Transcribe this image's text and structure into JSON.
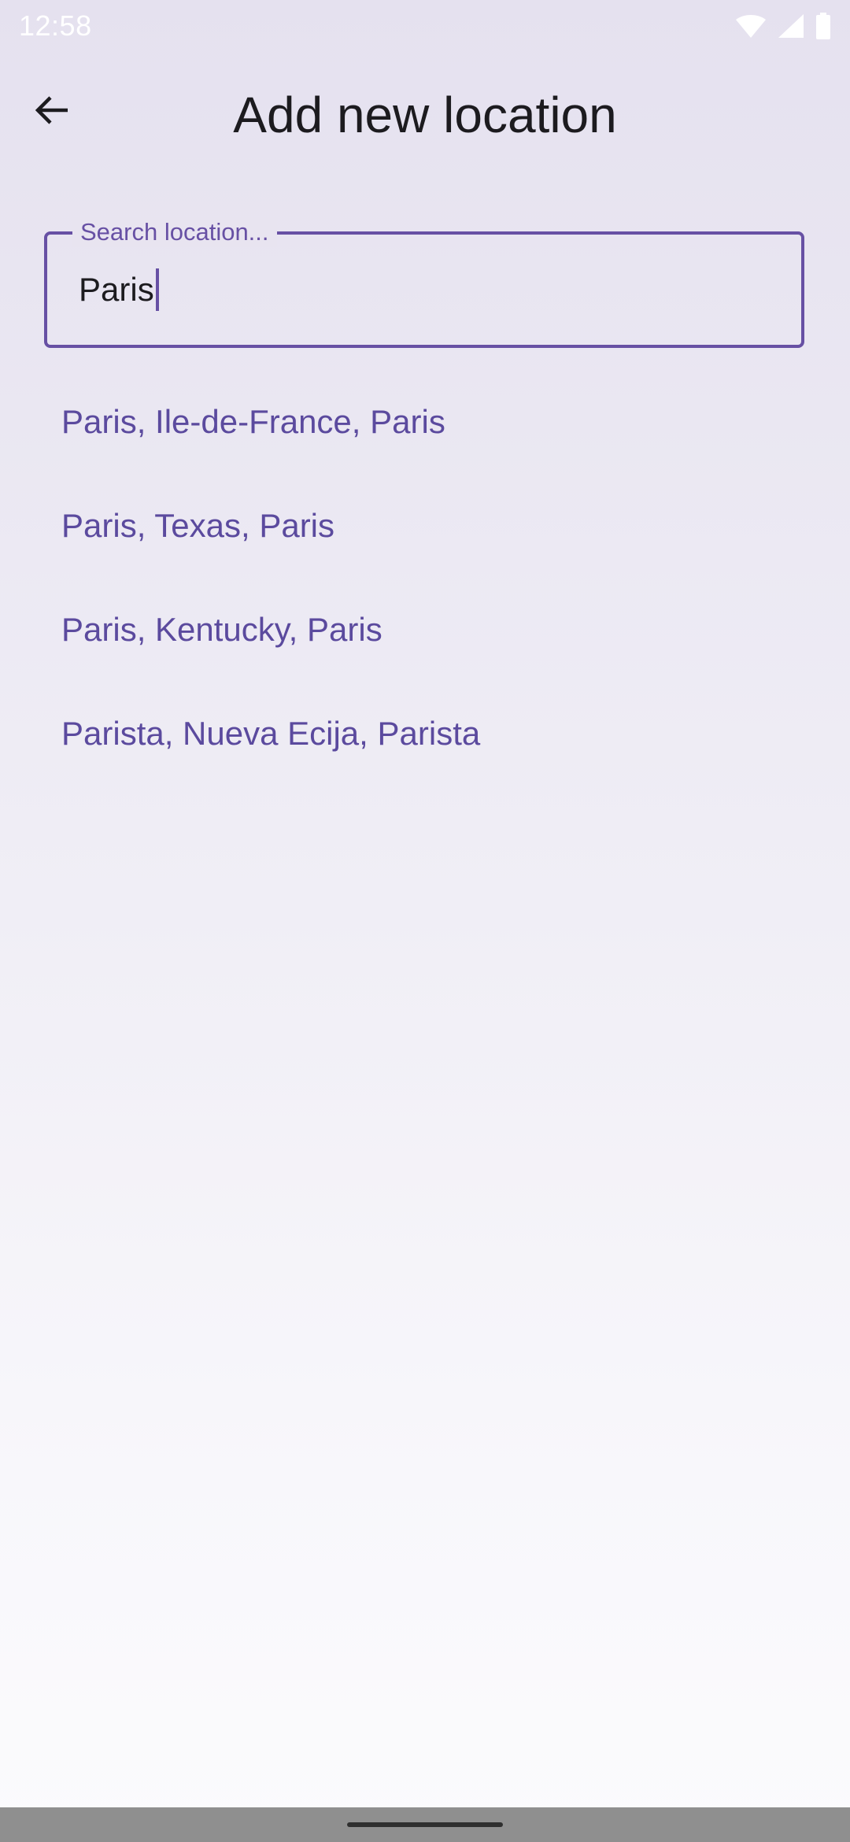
{
  "status_bar": {
    "time": "12:58",
    "icons": [
      "wifi-icon",
      "cell-signal-icon",
      "battery-icon"
    ]
  },
  "app_bar": {
    "back_icon": "arrow-back-icon",
    "title": "Add new location"
  },
  "search": {
    "label": "Search location...",
    "value": "Paris"
  },
  "suggestions": [
    "Paris, Ile-de-France, Paris",
    "Paris, Texas, Paris",
    "Paris, Kentucky, Paris",
    "Parista, Nueva Ecija, Parista"
  ],
  "colors": {
    "accent": "#6750a4",
    "suggestion_text": "#5b4a9e",
    "title_text": "#1c1b1f"
  }
}
